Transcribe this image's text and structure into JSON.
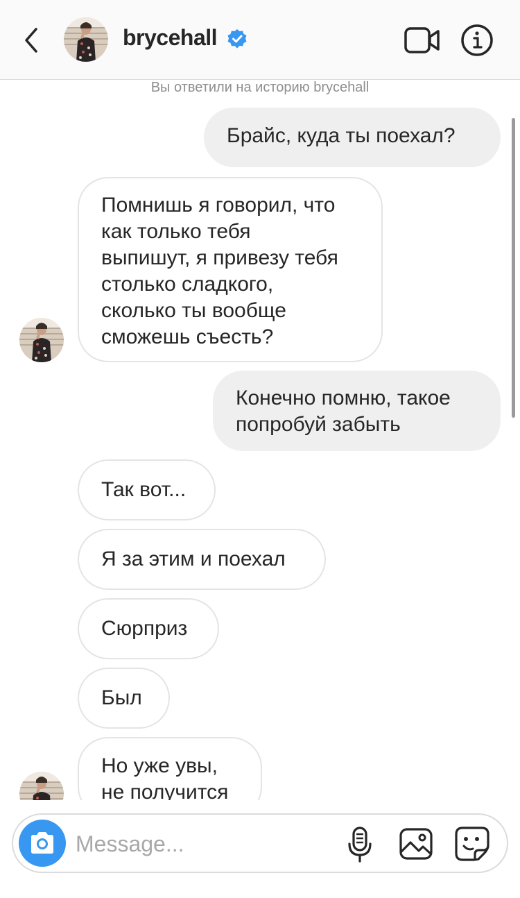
{
  "header": {
    "username": "brycehall",
    "verified": true,
    "icons": [
      "back-icon",
      "verified-badge-icon",
      "video-call-icon",
      "info-icon"
    ]
  },
  "chat": {
    "story_note": "Вы ответили на историю brycehall",
    "messages": [
      {
        "from": "me",
        "text": "Брайс, куда ты поехал?"
      },
      {
        "from": "them",
        "lines": [
          "Помнишь я говорил, что",
          "как только тебя",
          "выпишут, я привезу тебя",
          "столько сладкого,",
          "сколько ты вообще",
          "сможешь съесть?"
        ]
      },
      {
        "from": "me",
        "lines": [
          "Конечно помню, такое",
          "попробуй забыть"
        ]
      },
      {
        "from": "them",
        "text": "Так вот..."
      },
      {
        "from": "them",
        "text": "Я за этим и поехал"
      },
      {
        "from": "them",
        "text": "Сюрприз"
      },
      {
        "from": "them",
        "text": "Был"
      },
      {
        "from": "them",
        "lines": [
          "Но уже увы,",
          "не получится"
        ]
      }
    ]
  },
  "composer": {
    "placeholder": "Message...",
    "icons": [
      "camera-icon",
      "microphone-icon",
      "gallery-icon",
      "sticker-icon"
    ]
  },
  "colors": {
    "accent": "#3897f0",
    "verified": "#3897f0",
    "outgoing_bubble": "#efefef",
    "incoming_border": "#e4e4e4"
  }
}
